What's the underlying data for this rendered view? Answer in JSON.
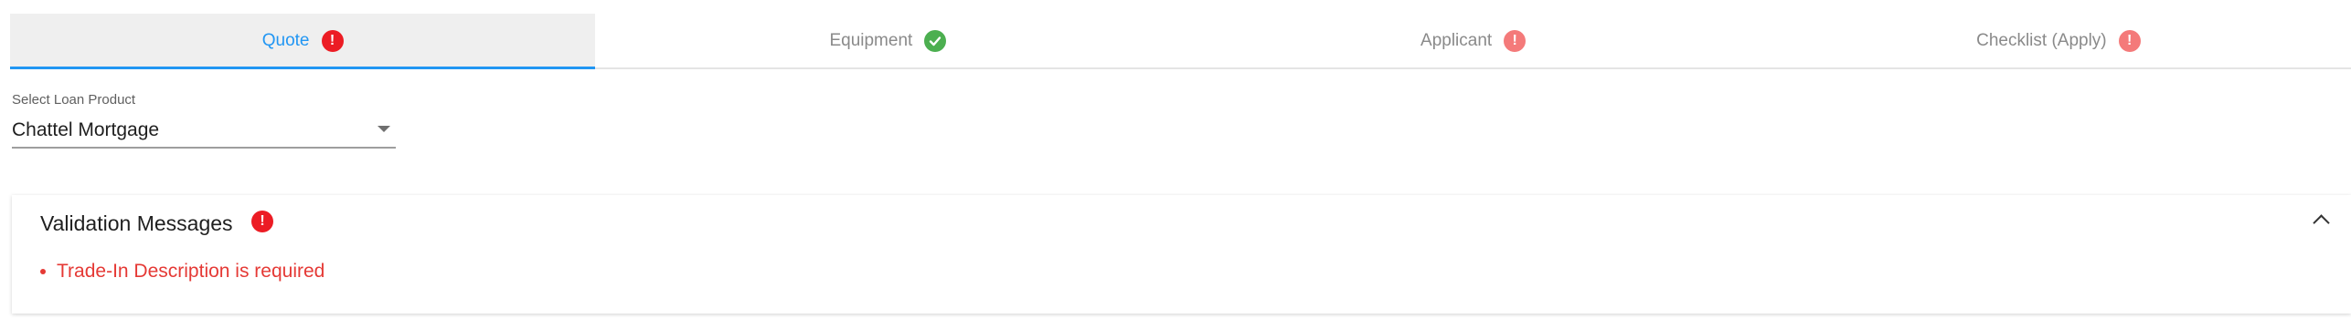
{
  "tabs": [
    {
      "label": "Quote",
      "status": "error",
      "status_glyph": "!",
      "icon": "error-icon",
      "active": true
    },
    {
      "label": "Equipment",
      "status": "complete",
      "icon": "check-circle-icon",
      "active": false
    },
    {
      "label": "Applicant",
      "status": "error",
      "status_glyph": "!",
      "icon": "error-icon",
      "active": false
    },
    {
      "label": "Checklist (Apply)",
      "status": "error",
      "status_glyph": "!",
      "icon": "error-icon",
      "active": false
    }
  ],
  "loan_product": {
    "label": "Select Loan Product",
    "value": "Chattel Mortgage"
  },
  "validation": {
    "title": "Validation Messages",
    "badge_glyph": "!",
    "expanded": true,
    "messages": [
      "Trade-In Description is required"
    ]
  },
  "colors": {
    "active_tab": "#2196f3",
    "error": "#ec1c24",
    "error_light": "#f47a7a",
    "success": "#4caf50",
    "message_text": "#e53935"
  }
}
